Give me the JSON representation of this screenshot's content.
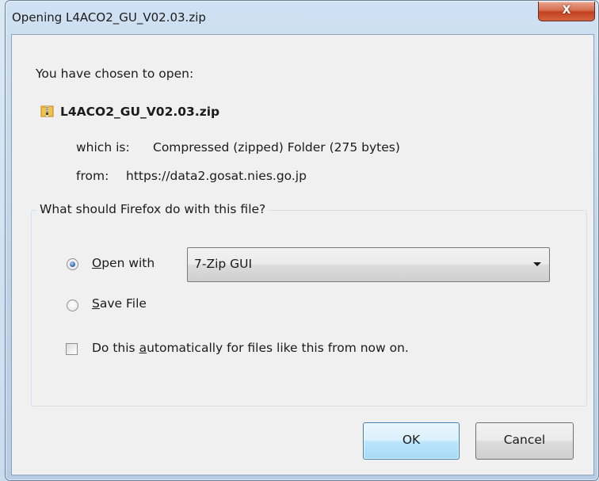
{
  "dialog": {
    "title": "Opening L4ACO2_GU_V02.03.zip",
    "close_label": "X"
  },
  "info": {
    "intro": "You have chosen to open:",
    "file_name": "L4ACO2_GU_V02.03.zip",
    "type_label": "which is:",
    "type_value": "Compressed (zipped) Folder (275 bytes)",
    "from_label": "from:",
    "from_value": "https://data2.gosat.nies.go.jp",
    "file_icon": "zip-folder-icon"
  },
  "action_group": {
    "label": "What should Firefox do with this file?",
    "open_with_prefix": "",
    "open_with_accel": "O",
    "open_with_rest": "pen with",
    "open_with_selected": true,
    "application": "7-Zip GUI",
    "save_accel": "S",
    "save_rest": "ave File",
    "auto_prefix": "Do this ",
    "auto_accel": "a",
    "auto_rest": "utomatically for files like this from now on.",
    "auto_checked": false
  },
  "buttons": {
    "ok": "OK",
    "cancel": "Cancel"
  },
  "colors": {
    "title_bar": "#c4d9ee",
    "close_button": "#c9452a",
    "client_background": "#f0f0f0",
    "default_button_border": "#3c7fb1"
  }
}
